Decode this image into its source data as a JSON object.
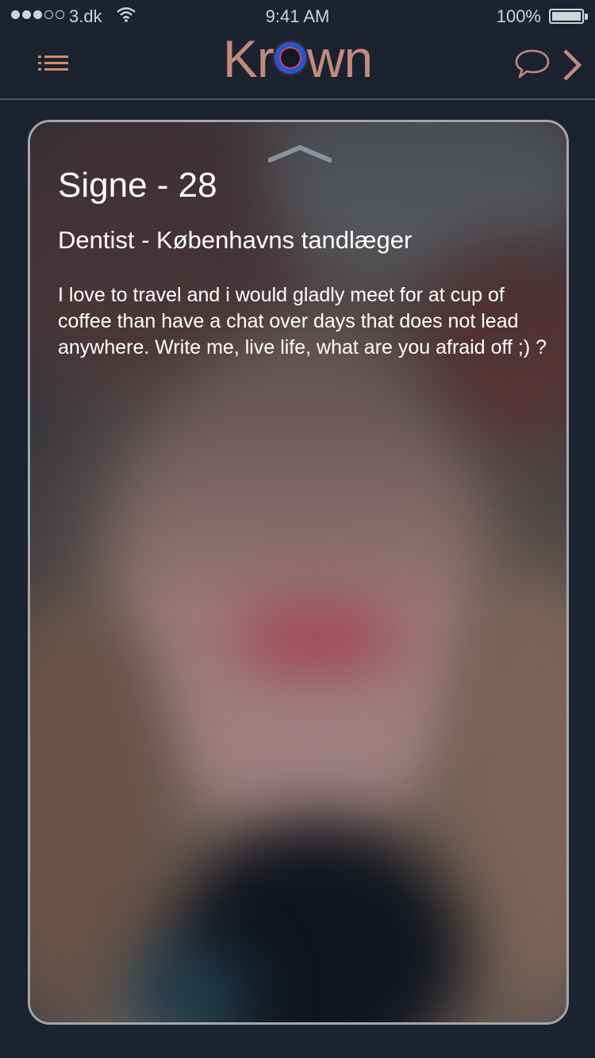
{
  "status_bar": {
    "carrier": "3.dk",
    "time": "9:41 AM",
    "battery": "100%",
    "battery_level": 1.0,
    "signal_bars_filled": 3,
    "signal_bars_total": 5
  },
  "nav": {
    "logo_prefix": "Kr",
    "logo_suffix": "wn",
    "menu_icon": "list-icon",
    "chat_icon": "speech-bubble-icon",
    "next_icon": "chevron-right-icon"
  },
  "profile": {
    "name_age": "Signe - 28",
    "occupation": "Dentist - Københavns tandlæger",
    "bio": "I love to travel and i would gladly meet for at cup of coffee than have a chat over days that does not lead anywhere. Write me, live life, what are you afraid off ;) ?",
    "collapse_icon": "chevron-up-icon"
  },
  "colors": {
    "background": "#1b2330",
    "accent": "#c48a7e",
    "logo_ring_blue": "#1f5ad0",
    "logo_ring_red": "#e0406a",
    "card_border": "#a2a7ae"
  }
}
